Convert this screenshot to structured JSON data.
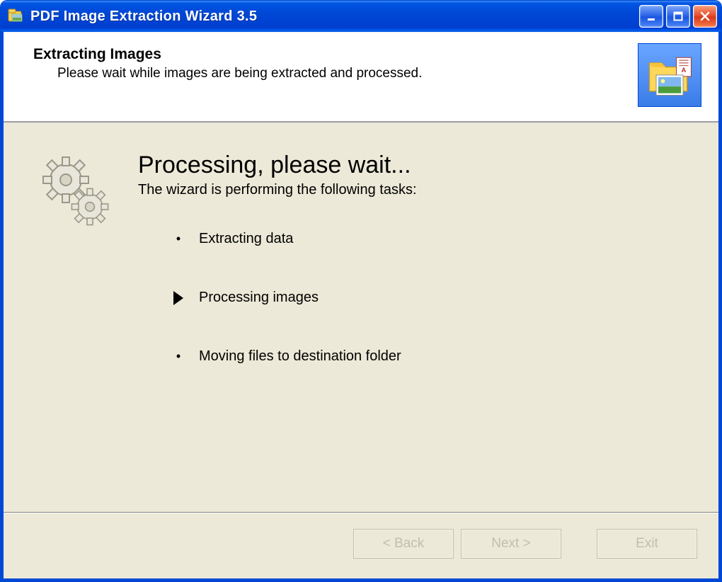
{
  "window": {
    "title": "PDF Image Extraction Wizard 3.5"
  },
  "header": {
    "title": "Extracting Images",
    "subtitle": "Please wait while images are being extracted and processed."
  },
  "processing": {
    "title": "Processing, please wait...",
    "subtitle": "The wizard is performing the following tasks:",
    "tasks": [
      {
        "label": "Extracting data",
        "current": false
      },
      {
        "label": "Processing images",
        "current": true
      },
      {
        "label": "Moving files to destination folder",
        "current": false
      }
    ]
  },
  "footer": {
    "back": "< Back",
    "next": "Next >",
    "exit": "Exit"
  }
}
